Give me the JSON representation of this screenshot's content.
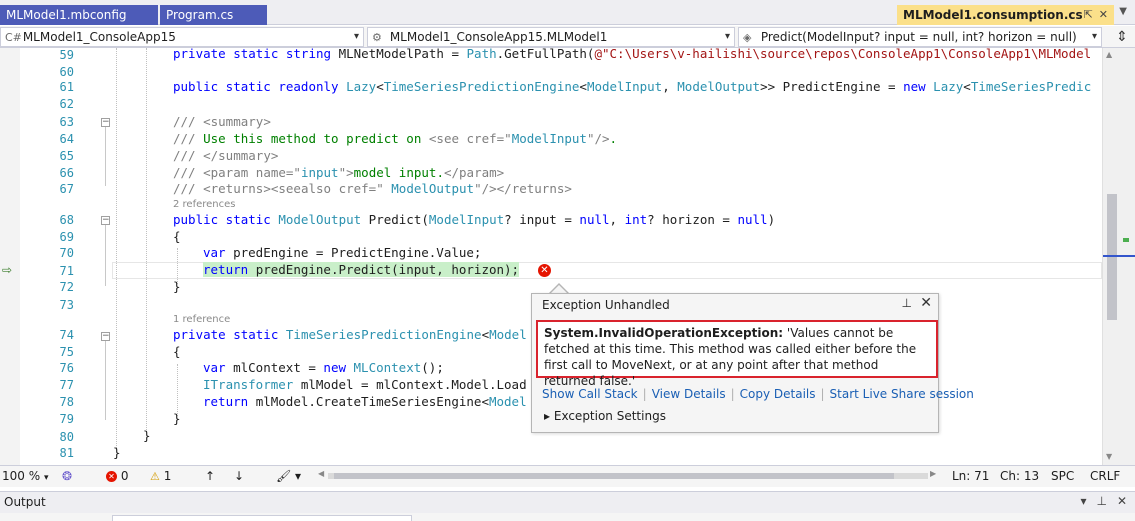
{
  "tabs": [
    {
      "label": "MLModel1.mbconfig",
      "active": false
    },
    {
      "label": "Program.cs",
      "active": false
    },
    {
      "label": "MLModel1.consumption.cs",
      "active": true
    }
  ],
  "active_tab_icons": [
    "pin-icon",
    "close-icon"
  ],
  "navbar": {
    "project": "MLModel1_ConsoleApp15",
    "class": "MLModel1_ConsoleApp15.MLModel1",
    "member": "Predict(ModelInput? input = null, int? horizon = null)"
  },
  "lines": [
    {
      "num": "59"
    },
    {
      "num": "60"
    },
    {
      "num": "61"
    },
    {
      "num": "62"
    },
    {
      "num": "63"
    },
    {
      "num": "64"
    },
    {
      "num": "65"
    },
    {
      "num": "66"
    },
    {
      "num": "67"
    },
    {
      "num": "68"
    },
    {
      "num": "69"
    },
    {
      "num": "70"
    },
    {
      "num": "71"
    },
    {
      "num": "72"
    },
    {
      "num": "73"
    },
    {
      "num": "74"
    },
    {
      "num": "75"
    },
    {
      "num": "76"
    },
    {
      "num": "77"
    },
    {
      "num": "78"
    },
    {
      "num": "79"
    },
    {
      "num": "80"
    },
    {
      "num": "81"
    }
  ],
  "code": {
    "l59": {
      "a": "private static string ",
      "b": "MLNetModelPath = ",
      "c": "Path",
      "d": ".GetFullPath(",
      "e": "@\"C:\\Users\\v-hailishi\\source\\repos\\ConsoleApp1\\ConsoleApp1\\MLModel"
    },
    "l61": {
      "a": "public static readonly ",
      "b": "Lazy",
      "c": "<",
      "d": "TimeSeriesPredictionEngine",
      "e": "<",
      "f": "ModelInput",
      "g": ", ",
      "h": "ModelOutput",
      "i": ">> PredictEngine = ",
      "j": "new ",
      "k": "Lazy",
      "l": "<",
      "m": "TimeSeriesPredic"
    },
    "l63": {
      "a": "/// ",
      "b": "<summary>"
    },
    "l64": {
      "a": "/// ",
      "b": "Use this method to predict on ",
      "c": "<see cref=\"",
      "d": "ModelInput",
      "e": "\"/>",
      "f": "."
    },
    "l65": {
      "a": "/// ",
      "b": "</summary>"
    },
    "l66": {
      "a": "/// ",
      "b": "<param name=\"",
      "c": "input",
      "d": "\">",
      "e": "model input.",
      "f": "</param>"
    },
    "l67": {
      "a": "/// ",
      "b": "<returns><seealso cref=\" ",
      "c": "ModelOutput",
      "d": "\"/></returns>"
    },
    "lens68": "2 references",
    "l68": {
      "a": "public static ",
      "b": "ModelOutput",
      "c": " Predict(",
      "d": "ModelInput",
      "e": "? input = ",
      "f": "null",
      "g": ", ",
      "h": "int",
      "i": "? horizon = ",
      "j": "null",
      "k": ")"
    },
    "l69": {
      "a": "{"
    },
    "l70": {
      "a": "var ",
      "b": "predEngine = PredictEngine.Value;"
    },
    "l71": {
      "a": "return ",
      "b": "predEngine.Predict(input, horizon);"
    },
    "l72": {
      "a": "}"
    },
    "lens74": "1 reference",
    "l74": {
      "a": "private static ",
      "b": "TimeSeriesPredictionEngine",
      "c": "<",
      "d": "Model"
    },
    "l75": {
      "a": "{"
    },
    "l76": {
      "a": "var ",
      "b": "mlContext = ",
      "c": "new ",
      "d": "MLContext",
      "e": "();"
    },
    "l77": {
      "a": "ITransformer",
      "b": " mlModel = mlContext.Model.Load"
    },
    "l78": {
      "a": "return ",
      "b": "mlModel.CreateTimeSeriesEngine<",
      "c": "Model"
    },
    "l79": {
      "a": "}"
    },
    "l80": {
      "a": "}"
    },
    "l81": {
      "a": "}"
    }
  },
  "exception_popup": {
    "title": "Exception Unhandled",
    "exception_type": "System.InvalidOperationException:",
    "message": " 'Values cannot be fetched at this time. This method was called either before the first call to MoveNext, or at any point after that method returned false.'",
    "links": [
      "Show Call Stack",
      "View Details",
      "Copy Details",
      "Start Live Share session"
    ],
    "settings": "Exception Settings"
  },
  "status": {
    "zoom": "100 %",
    "errors": "0",
    "warnings": "1",
    "line": "Ln: 71",
    "col": "Ch: 13",
    "whitespace": "SPC",
    "line_ending": "CRLF"
  },
  "output_panel": {
    "title": "Output"
  },
  "colors": {
    "tab_active": "#fbe08a",
    "tab_inactive": "#3f51b5",
    "error_red": "#e51400",
    "keyword": "#0000ff",
    "type": "#2b91af",
    "comment": "#008000",
    "current_line_bg": "#c9efc9"
  }
}
